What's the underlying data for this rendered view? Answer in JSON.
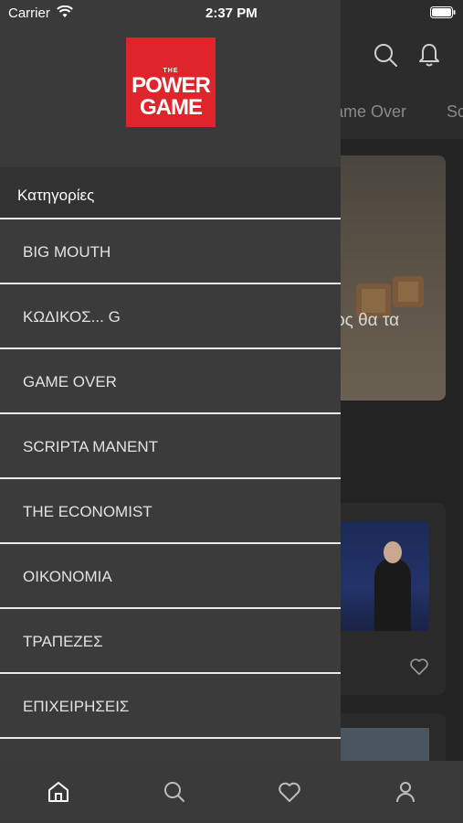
{
  "status_bar": {
    "carrier": "Carrier",
    "time": "2:37 PM"
  },
  "background": {
    "tabs": [
      "ame Over",
      "Sc"
    ],
    "card_headline": "πώς θα τα"
  },
  "drawer": {
    "logo": {
      "the": "THE",
      "line1": "POWER",
      "line2": "GAME",
      "color": "#e0242c"
    },
    "categories_title": "Κατηγορίες",
    "items": [
      {
        "label": "BIG MOUTH"
      },
      {
        "label": "ΚΩΔΙΚΟΣ... G"
      },
      {
        "label": "GAME OVER"
      },
      {
        "label": "SCRIPTA MANENT"
      },
      {
        "label": "THE ECONOMIST"
      },
      {
        "label": "ΟΙΚΟΝΟΜΙΑ"
      },
      {
        "label": "ΤΡΑΠΕΖΕΣ"
      },
      {
        "label": "ΕΠΙΧΕΙΡΗΣΕΙΣ"
      }
    ]
  },
  "tab_bar": {
    "items": [
      {
        "icon": "home-icon",
        "active": true
      },
      {
        "icon": "search-icon",
        "active": false
      },
      {
        "icon": "heart-icon",
        "active": false
      },
      {
        "icon": "user-icon",
        "active": false
      }
    ]
  }
}
